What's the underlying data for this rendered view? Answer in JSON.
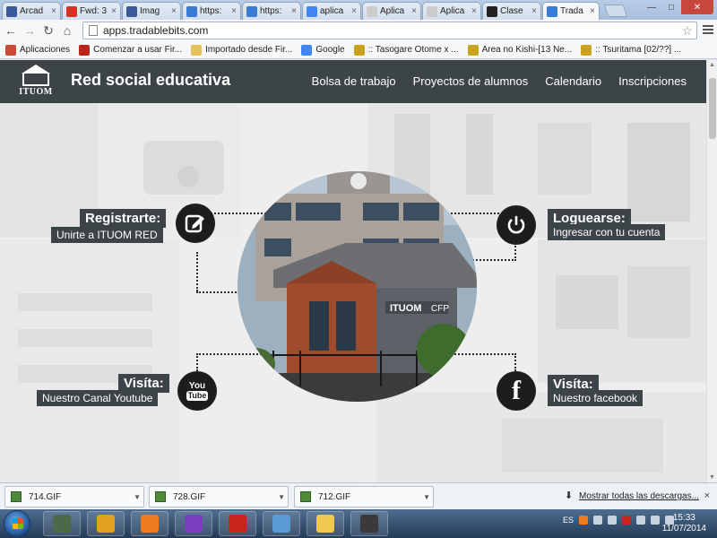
{
  "browser": {
    "tabs": [
      {
        "title": "Arcad",
        "icon": "facebook-icon",
        "color": "#3b5998"
      },
      {
        "title": "Fwd: 3",
        "icon": "gmail-icon",
        "color": "#d93025"
      },
      {
        "title": "Imag",
        "icon": "facebook-icon",
        "color": "#3b5998"
      },
      {
        "title": "https:",
        "icon": "multicolor-site-icon",
        "color": "#3a7bd5"
      },
      {
        "title": "https:",
        "icon": "multicolor-site-icon",
        "color": "#3a7bd5"
      },
      {
        "title": "aplica",
        "icon": "google-icon",
        "color": "#4285f4"
      },
      {
        "title": "Aplica",
        "icon": "page-icon",
        "color": "#cccccc"
      },
      {
        "title": "Aplica",
        "icon": "page-icon",
        "color": "#cccccc"
      },
      {
        "title": "Clase",
        "icon": "dark-site-icon",
        "color": "#222222"
      },
      {
        "title": "Trada",
        "icon": "multicolor-site-icon",
        "color": "#3a7bd5"
      }
    ],
    "url": "apps.tradablebits.com",
    "bookmarks": [
      {
        "label": "Aplicaciones",
        "icon": "apps-grid-icon",
        "color": "#d04a3a"
      },
      {
        "label": "Comenzar a usar Fir...",
        "icon": "firefox-icon",
        "color": "#b8261c"
      },
      {
        "label": "Importado desde Fir...",
        "icon": "folder-icon",
        "color": "#e8c25a"
      },
      {
        "label": "Google",
        "icon": "google-icon",
        "color": "#4285f4"
      },
      {
        "label": ":: Tasogare Otome x ...",
        "icon": "mc-icon",
        "color": "#c9a320"
      },
      {
        "label": "Area no Kishi-[13 Ne...",
        "icon": "mc-icon",
        "color": "#c9a320"
      },
      {
        "label": ":: Tsuritama [02/??] ...",
        "icon": "mc-icon",
        "color": "#c9a320"
      }
    ]
  },
  "site": {
    "logo_text": "ITUOM",
    "title": "Red social educativa",
    "nav": [
      "Bolsa de trabajo",
      "Proyectos de alumnos",
      "Calendario",
      "Inscripciones"
    ],
    "building_sign": "ITUOM",
    "building_sign_right": "CFP",
    "actions": {
      "register": {
        "title": "Registrarte:",
        "subtitle": "Unirte a ITUOM RED",
        "icon": "edit-icon"
      },
      "login": {
        "title": "Loguearse:",
        "subtitle": "Ingresar con tu cuenta",
        "icon": "power-icon"
      },
      "youtube": {
        "title": "Visíta:",
        "subtitle": "Nuestro Canal Youtube",
        "icon": "youtube-icon",
        "icon_text_top": "You",
        "icon_text_bottom": "Tube"
      },
      "facebook": {
        "title": "Visíta:",
        "subtitle": "Nuestro facebook",
        "icon": "facebook-icon",
        "icon_text": "f"
      }
    }
  },
  "downloads": {
    "items": [
      "714.GIF",
      "728.GIF",
      "712.GIF"
    ],
    "show_all": "Mostrar todas las descargas...",
    "close": "×"
  },
  "taskbar": {
    "lang": "ES",
    "time": "15:33",
    "date": "11/07/2014",
    "apps": [
      {
        "name": "screen-app-icon",
        "color": "#4a6a4a"
      },
      {
        "name": "chrome-icon",
        "color": "#e0a020"
      },
      {
        "name": "xampp-icon",
        "color": "#f07b21"
      },
      {
        "name": "color-grid-icon",
        "color": "#7a3fbf"
      },
      {
        "name": "filezilla-icon",
        "color": "#c9251c"
      },
      {
        "name": "paint-icon",
        "color": "#5b9bd5"
      },
      {
        "name": "explorer-folder-icon",
        "color": "#f0c850"
      },
      {
        "name": "sublime-icon",
        "color": "#3a3a3a"
      }
    ]
  },
  "colors": {
    "header_bg": "#3d4448",
    "label_bg": "#3d4448",
    "icon_bg": "#1d1d1d"
  }
}
